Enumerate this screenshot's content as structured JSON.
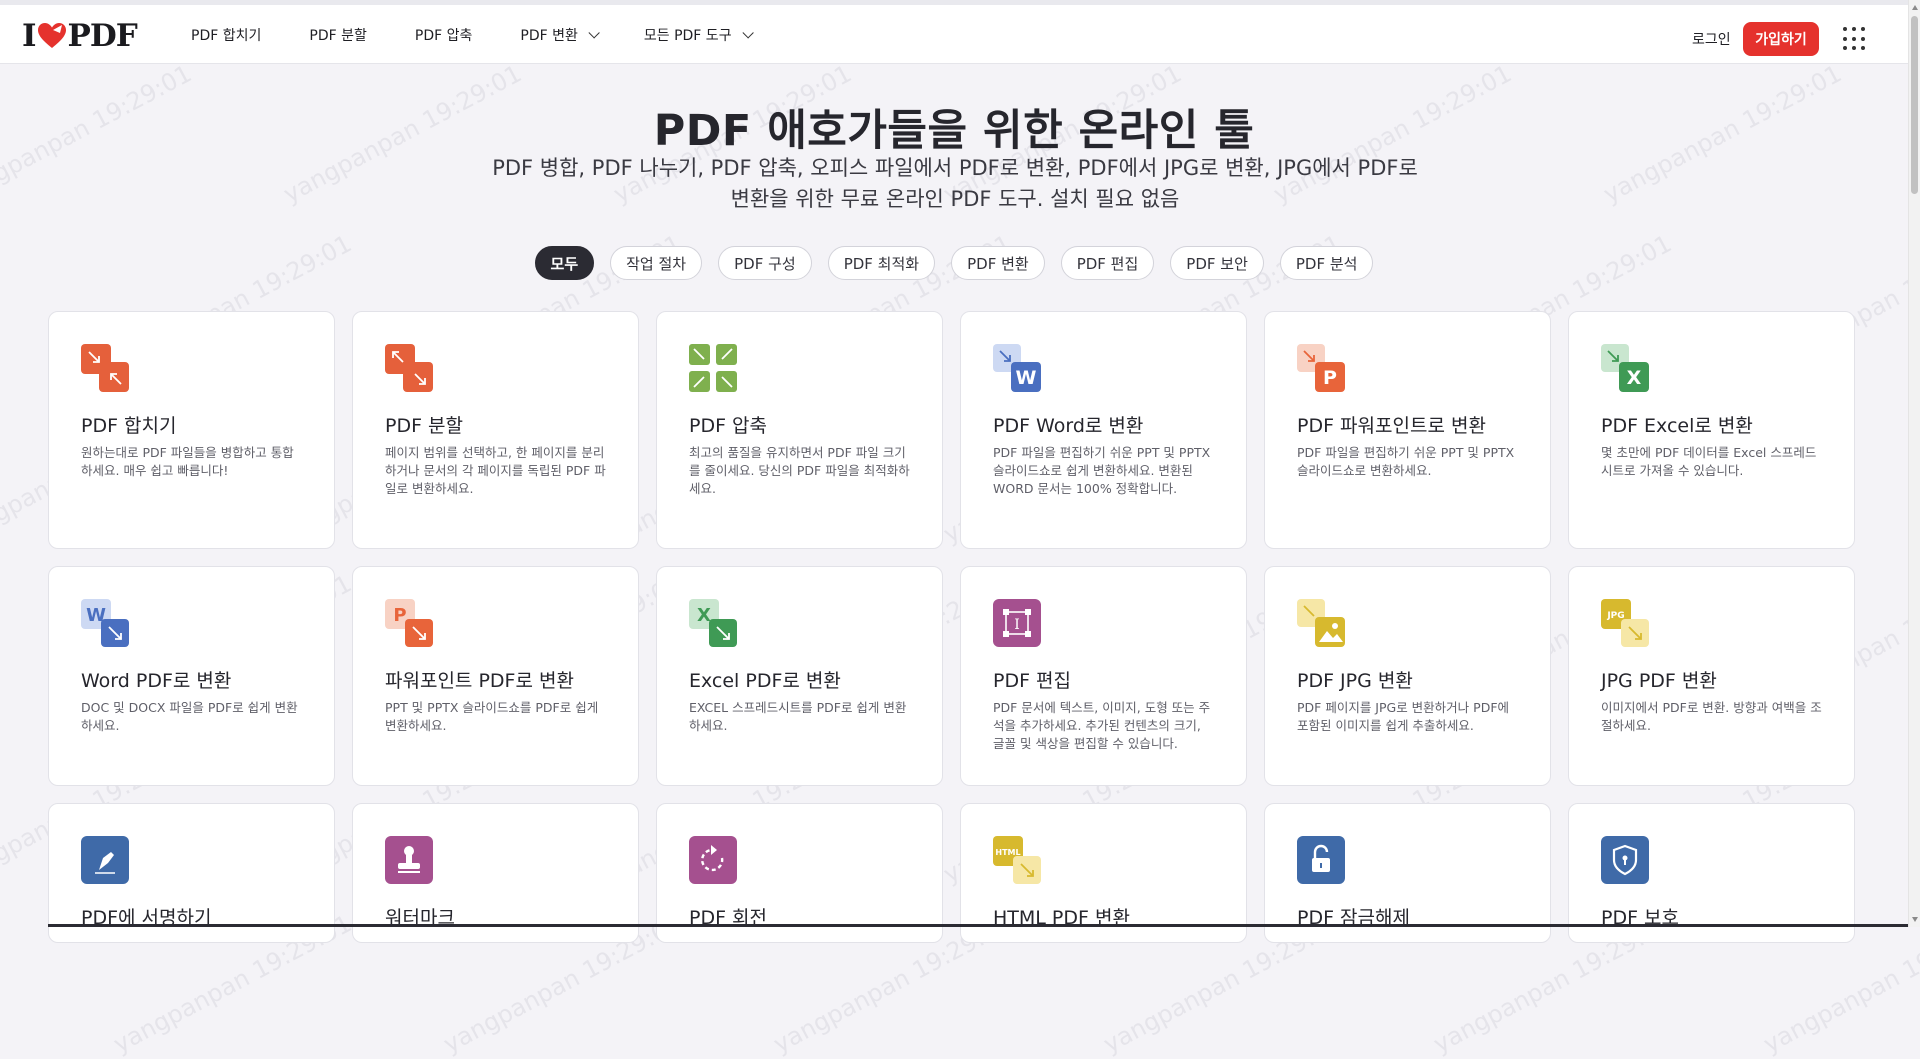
{
  "logo": {
    "left": "I",
    "right": "PDF",
    "icon": "heart-icon",
    "color": "#e5322d"
  },
  "nav": [
    {
      "label": "PDF 합치기",
      "dropdown": false
    },
    {
      "label": "PDF 분할",
      "dropdown": false
    },
    {
      "label": "PDF 압축",
      "dropdown": false
    },
    {
      "label": "PDF 변환",
      "dropdown": true
    },
    {
      "label": "모든 PDF 도구",
      "dropdown": true
    }
  ],
  "header": {
    "login_label": "로그인",
    "signup_label": "가입하기",
    "apps_icon": "grid-dots-icon"
  },
  "hero": {
    "title": "PDF 애호가들을 위한 온라인 툴",
    "subtitle_line1": "PDF 병합, PDF 나누기, PDF 압축, 오피스 파일에서 PDF로 변환, PDF에서 JPG로 변환, JPG에서 PDF로",
    "subtitle_line2": "변환을 위한 무료 온라인 PDF 도구. 설치 필요 없음"
  },
  "filters": [
    {
      "label": "모두",
      "active": true
    },
    {
      "label": "작업 절차",
      "active": false
    },
    {
      "label": "PDF 구성",
      "active": false
    },
    {
      "label": "PDF 최적화",
      "active": false
    },
    {
      "label": "PDF 변환",
      "active": false
    },
    {
      "label": "PDF 편집",
      "active": false
    },
    {
      "label": "PDF 보안",
      "active": false
    },
    {
      "label": "PDF 분석",
      "active": false
    }
  ],
  "tools": [
    {
      "title": "PDF 합치기",
      "desc": "원하는대로 PDF 파일들을 병합하고 통합하세요. 매우 쉽고 빠릅니다!",
      "icon": "merge-icon",
      "color": "#e5603b"
    },
    {
      "title": "PDF 분할",
      "desc": "페이지 범위를 선택하고, 한 페이지를 분리하거나 문서의 각 페이지를 독립된 PDF 파일로 변환하세요.",
      "icon": "split-icon",
      "color": "#e5603b"
    },
    {
      "title": "PDF 압축",
      "desc": "최고의 품질을 유지하면서 PDF 파일 크기를 줄이세요. 당신의 PDF 파일을 최적화하세요.",
      "icon": "compress-icon",
      "color": "#7fb04e"
    },
    {
      "title": "PDF Word로 변환",
      "desc": "PDF 파일을 편집하기 쉬운 PPT 및 PPTX 슬라이드쇼로 쉽게 변환하세요. 변환된 WORD 문서는 100% 정확합니다.",
      "icon": "pdf-to-word-icon",
      "color": "#4a6fc0"
    },
    {
      "title": "PDF 파워포인트로 변환",
      "desc": "PDF 파일을 편집하기 쉬운 PPT 및 PPTX 슬라이드쇼로 변환하세요.",
      "icon": "pdf-to-powerpoint-icon",
      "color": "#e8643a"
    },
    {
      "title": "PDF Excel로 변환",
      "desc": "몇 초만에 PDF 데이터를 Excel 스프레드 시트로 가져올 수 있습니다.",
      "icon": "pdf-to-excel-icon",
      "color": "#3f9a55"
    },
    {
      "title": "Word PDF로 변환",
      "desc": "DOC 및 DOCX 파일을 PDF로 쉽게 변환하세요.",
      "icon": "word-to-pdf-icon",
      "color": "#4a6fc0"
    },
    {
      "title": "파워포인트 PDF로 변환",
      "desc": "PPT 및 PPTX 슬라이드쇼를 PDF로 쉽게 변환하세요.",
      "icon": "powerpoint-to-pdf-icon",
      "color": "#e8643a"
    },
    {
      "title": "Excel PDF로 변환",
      "desc": "EXCEL 스프레드시트를 PDF로 쉽게 변환하세요.",
      "icon": "excel-to-pdf-icon",
      "color": "#3f9a55"
    },
    {
      "title": "PDF 편집",
      "desc": "PDF 문서에 텍스트, 이미지, 도형 또는 주석을 추가하세요. 추가된 컨텐츠의 크기, 글꼴 및 색상을 편집할 수 있습니다.",
      "icon": "edit-pdf-icon",
      "color": "#a5508f"
    },
    {
      "title": "PDF JPG 변환",
      "desc": "PDF 페이지를 JPG로 변환하거나 PDF에 포함된 이미지를 쉽게 추출하세요.",
      "icon": "pdf-to-jpg-icon",
      "color": "#d7b92e"
    },
    {
      "title": "JPG PDF 변환",
      "desc": "이미지에서 PDF로 변환. 방향과 여백을 조절하세요.",
      "icon": "jpg-to-pdf-icon",
      "color": "#d7b92e"
    },
    {
      "title": "PDF에 서명하기",
      "desc": "",
      "icon": "sign-pdf-icon",
      "color": "#3f6aa8"
    },
    {
      "title": "워터마크",
      "desc": "",
      "icon": "watermark-icon",
      "color": "#a5508f"
    },
    {
      "title": "PDF 회전",
      "desc": "",
      "icon": "rotate-icon",
      "color": "#a5508f"
    },
    {
      "title": "HTML PDF 변환",
      "desc": "",
      "icon": "html-to-pdf-icon",
      "color": "#d7b92e"
    },
    {
      "title": "PDF 잠금해제",
      "desc": "",
      "icon": "unlock-icon",
      "color": "#3f6aa8"
    },
    {
      "title": "PDF 보호",
      "desc": "",
      "icon": "protect-icon",
      "color": "#3f6aa8"
    }
  ],
  "watermark": {
    "text": "yangpanpan 19:29:01"
  }
}
